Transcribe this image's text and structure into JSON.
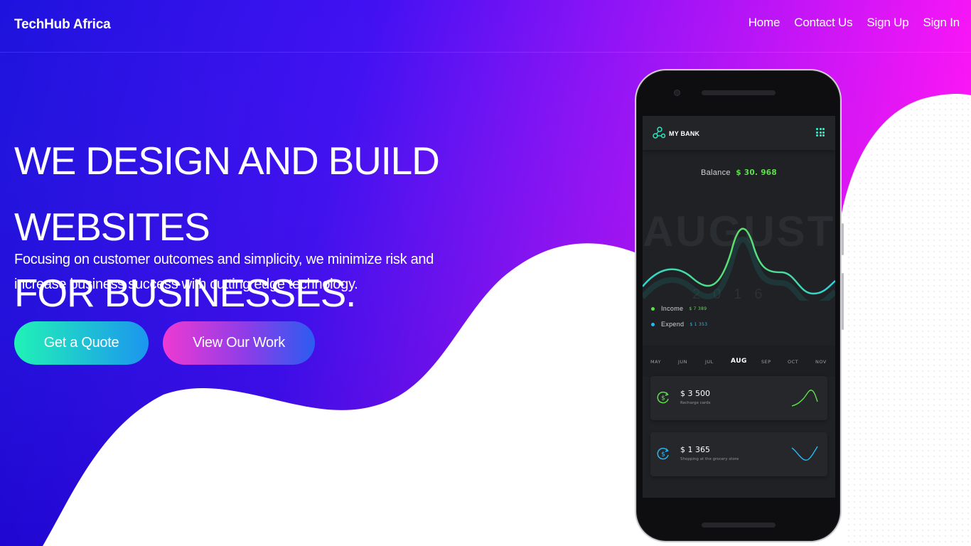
{
  "colors": {
    "hero_gradient_left": "#1a0ae0",
    "hero_gradient_mid": "#4a0cf6",
    "hero_gradient_right": "#f60cf4",
    "quote_btn": [
      "#21f2b6",
      "#1c95ef"
    ],
    "work_btn": [
      "#ef3ad2",
      "#2b5cf1"
    ],
    "income": "#5de04a",
    "expend": "#2bb6f2"
  },
  "navbar": {
    "brand": "TechHub Africa",
    "links": [
      {
        "label": "Home"
      },
      {
        "label": "Contact Us"
      },
      {
        "label": "Sign Up"
      },
      {
        "label": "Sign In"
      }
    ]
  },
  "hero": {
    "headline_line1": "WE DESIGN AND BUILD WEBSITES",
    "headline_line2": "FOR BUSINESSES.",
    "subtext": "Focusing on customer outcomes and simplicity, we minimize risk and increase business success with cutting edge technology.",
    "buttons": {
      "quote": "Get a Quote",
      "work": "View Our Work"
    }
  },
  "phone_app": {
    "title": "MY BANK",
    "balance_label": "Balance",
    "balance_value": "$ 30. 968",
    "month_watermark": "AUGUST",
    "year_watermark": "2016",
    "legend": [
      {
        "label": "Income",
        "value": "$ 7 389",
        "icon": "green-dot"
      },
      {
        "label": "Expend",
        "value": "$ 1 353",
        "icon": "blue-dot"
      }
    ],
    "months": [
      "MAY",
      "JUN",
      "JUL",
      "AUG",
      "SEP",
      "OCT",
      "NOV"
    ],
    "active_month": "AUG",
    "transactions": [
      {
        "amount": "$ 3 500",
        "description": "Recharge cards",
        "icon": "dollar-refresh-icon"
      },
      {
        "amount": "$ 1 365",
        "description": "Shopping at the grocery store",
        "icon": "dollar-refresh-icon"
      }
    ]
  }
}
